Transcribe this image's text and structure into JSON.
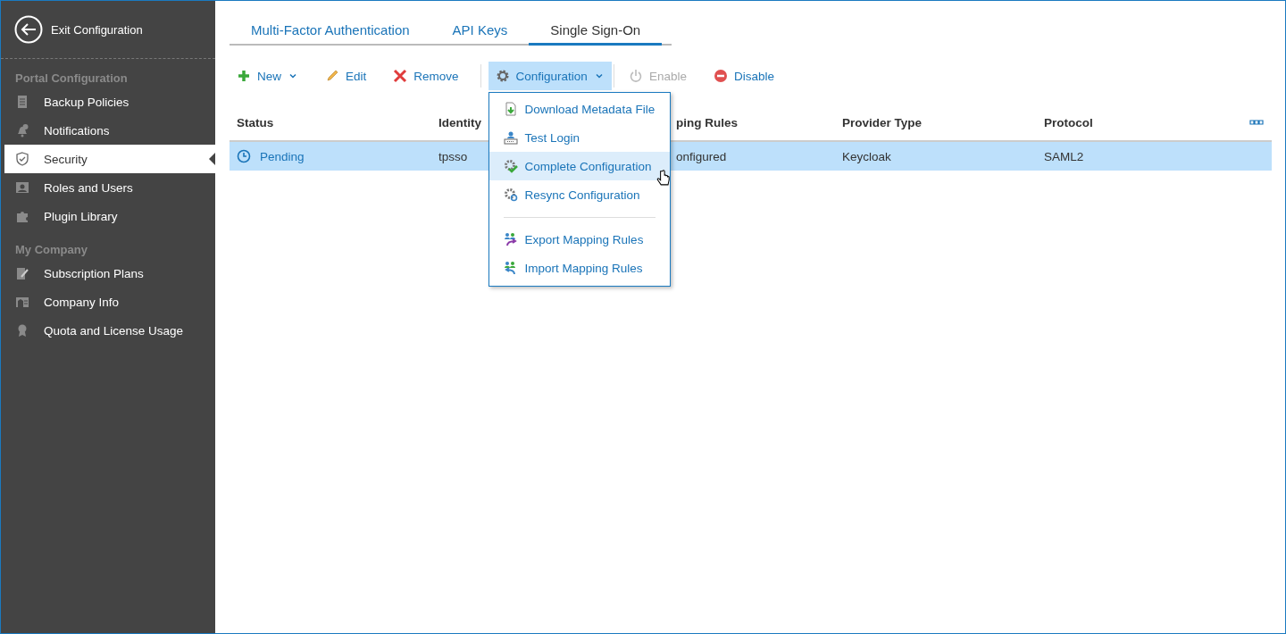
{
  "sidebar": {
    "exit_label": "Exit Configuration",
    "sections": [
      {
        "title": "Portal Configuration",
        "items": [
          {
            "label": "Backup Policies",
            "selected": false
          },
          {
            "label": "Notifications",
            "selected": false
          },
          {
            "label": "Security",
            "selected": true
          },
          {
            "label": "Roles and Users",
            "selected": false
          },
          {
            "label": "Plugin Library",
            "selected": false
          }
        ]
      },
      {
        "title": "My Company",
        "items": [
          {
            "label": "Subscription Plans",
            "selected": false
          },
          {
            "label": "Company Info",
            "selected": false
          },
          {
            "label": "Quota and License Usage",
            "selected": false
          }
        ]
      }
    ]
  },
  "tabs": [
    {
      "label": "Multi-Factor Authentication",
      "selected": false
    },
    {
      "label": "API Keys",
      "selected": false
    },
    {
      "label": "Single Sign-On",
      "selected": true
    }
  ],
  "toolbar": [
    {
      "label": "New",
      "kind": "new",
      "disabled": false,
      "dropdown": true,
      "expanded": false
    },
    {
      "label": "Edit",
      "kind": "edit",
      "disabled": false,
      "dropdown": false,
      "expanded": false
    },
    {
      "label": "Remove",
      "kind": "remove",
      "disabled": false,
      "dropdown": false,
      "expanded": false
    },
    {
      "label": "Configuration",
      "kind": "config",
      "disabled": false,
      "dropdown": true,
      "expanded": true
    },
    {
      "label": "Enable",
      "kind": "enable",
      "disabled": true,
      "dropdown": false,
      "expanded": false
    },
    {
      "label": "Disable",
      "kind": "disable",
      "disabled": false,
      "dropdown": false,
      "expanded": false
    }
  ],
  "menu": {
    "groups": [
      [
        {
          "label": "Download Metadata File",
          "kind": "download",
          "hovered": false
        },
        {
          "label": "Test Login",
          "kind": "login",
          "hovered": false
        },
        {
          "label": "Complete Configuration",
          "kind": "complete",
          "hovered": true
        },
        {
          "label": "Resync Configuration",
          "kind": "resync",
          "hovered": false
        }
      ],
      [
        {
          "label": "Export Mapping Rules",
          "kind": "export",
          "hovered": false
        },
        {
          "label": "Import Mapping Rules",
          "kind": "import",
          "hovered": false
        }
      ]
    ]
  },
  "table": {
    "columns": [
      "Status",
      "Identity",
      "ping Rules",
      "Provider Type",
      "Protocol"
    ],
    "rows": [
      {
        "selected": true,
        "cells": [
          "Pending",
          "tpsso",
          "onfigured",
          "Keycloak",
          "SAML2"
        ]
      }
    ]
  }
}
